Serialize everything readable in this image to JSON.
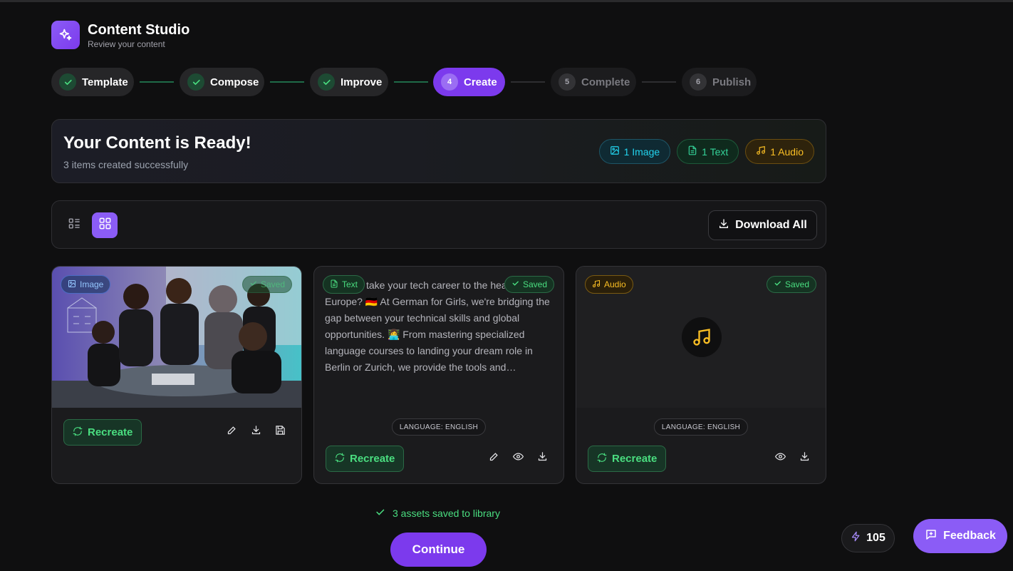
{
  "app": {
    "title": "Content Studio",
    "subtitle": "Review your content"
  },
  "stepper": {
    "steps": [
      {
        "label": "Template",
        "state": "done"
      },
      {
        "number": "4",
        "label": "Create",
        "state": "active"
      },
      {
        "label": "Compose",
        "state": "done"
      },
      {
        "label": "Improve",
        "state": "done"
      },
      {
        "number": "5",
        "label": "Complete",
        "state": "pending"
      },
      {
        "number": "6",
        "label": "Publish",
        "state": "pending"
      }
    ]
  },
  "banner": {
    "title": "Your Content is Ready!",
    "subtitle": "3 items created successfully",
    "counts": {
      "image": "1 Image",
      "text": "1 Text",
      "audio": "1 Audio"
    }
  },
  "toolbar": {
    "download_all": "Download All"
  },
  "cards": [
    {
      "type_label": "Image",
      "saved_label": "Saved",
      "recreate_label": "Recreate"
    },
    {
      "type_label": "Text",
      "saved_label": "Saved",
      "preview": "take your tech career to the heart of Europe? 🇩🇪 At German for Girls, we're bridging the gap between your technical skills and global opportunities. 👩‍💻 From mastering specialized language courses to landing your dream role in Berlin or Zurich, we provide the tools and…",
      "language": "LANGUAGE: ENGLISH",
      "recreate_label": "Recreate"
    },
    {
      "type_label": "Audio",
      "saved_label": "Saved",
      "language": "LANGUAGE: ENGLISH",
      "recreate_label": "Recreate"
    }
  ],
  "footer": {
    "saved_note": "3 assets saved to library",
    "continue": "Continue",
    "credits": "105",
    "feedback": "Feedback"
  },
  "colors": {
    "accent": "#7c3aed",
    "success": "#4ade80",
    "image": "#22d3ee",
    "audio": "#fbbf24"
  }
}
